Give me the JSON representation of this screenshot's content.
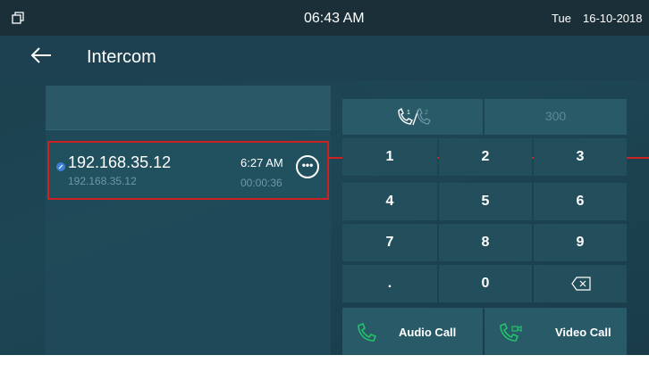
{
  "statusbar": {
    "time": "06:43 AM",
    "day": "Tue",
    "date": "16-10-2018"
  },
  "header": {
    "title": "Intercom"
  },
  "records": [
    {
      "name": "192.168.35.12",
      "sub": "192.168.35.12",
      "time": "6:27 AM",
      "duration": "00:00:36",
      "more_label": "•••"
    }
  ],
  "keypad": {
    "number": "300",
    "keys": [
      "1",
      "2",
      "3",
      "4",
      "5",
      "6",
      "7",
      "8",
      "9",
      ".",
      "0"
    ]
  },
  "buttons": {
    "audio_call": "Audio Call",
    "video_call": "Video Call"
  },
  "colors": {
    "accent": "#cc2222",
    "call_icon": "#22c36a"
  },
  "icons": {
    "status": "window-icon",
    "back": "back-arrow-icon",
    "line": "phone-line-icon",
    "backspace": "backspace-icon",
    "audio": "phone-icon",
    "video": "video-phone-icon"
  }
}
